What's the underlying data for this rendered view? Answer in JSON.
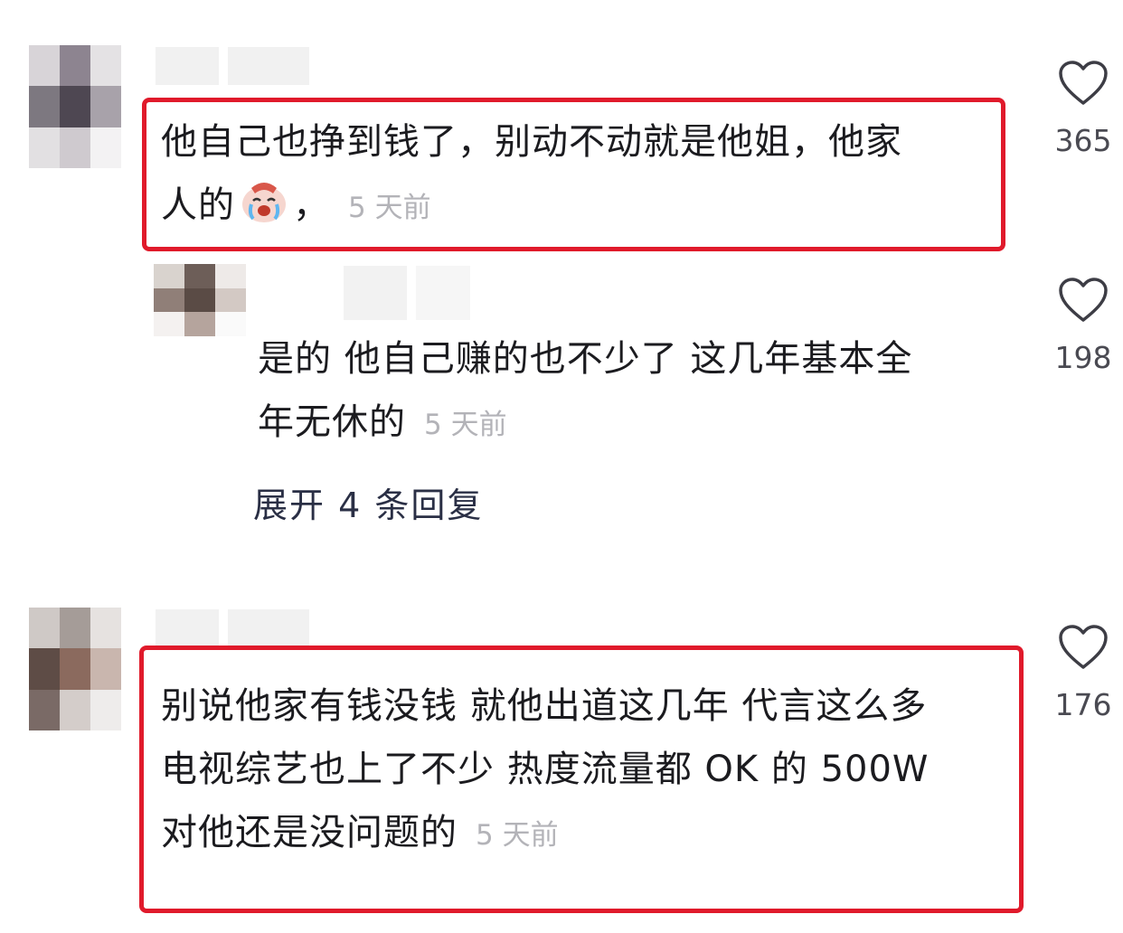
{
  "comments": [
    {
      "text_line1": "他自己也挣到钱了，别动不动就是他姐，他家",
      "text_line2": "人的",
      "text_after_emoji": "，",
      "emoji": "cry-laugh-emoji",
      "time": "5 天前",
      "likes": "365"
    },
    {
      "text_line1": "是的  他自己赚的也不少了 这几年基本全",
      "text_line2": "年无休的",
      "time": "5 天前",
      "likes": "198",
      "expand_label": "展开 4 条回复"
    },
    {
      "text_line1": "别说他家有钱没钱 就他出道这几年 代言这么多",
      "text_line2": "电视综艺也上了不少  热度流量都 OK 的 500W",
      "text_line3": "对他还是没问题的",
      "time": "5 天前",
      "likes": "176"
    }
  ],
  "colors": {
    "highlight": "#e01a2b",
    "timestamp": "#b3b3b8"
  },
  "icons": [
    "heart-outline-icon"
  ]
}
